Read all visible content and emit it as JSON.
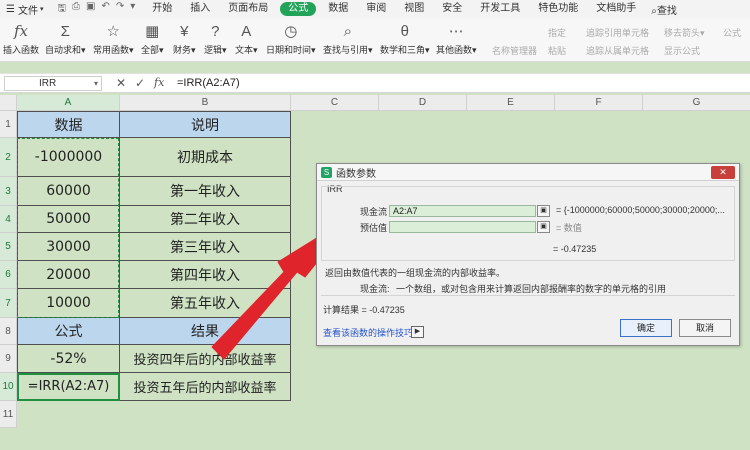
{
  "menu": {
    "file": "文件",
    "tabs": [
      "开始",
      "插入",
      "页面布局",
      "公式",
      "数据",
      "审阅",
      "视图",
      "安全",
      "开发工具",
      "特色功能",
      "文档助手"
    ],
    "active_tab": "公式",
    "search": "查找"
  },
  "ribbon": {
    "buttons": [
      {
        "label": "插入函数",
        "icon": "fx"
      },
      {
        "label": "自动求和▾",
        "icon": "Σ"
      },
      {
        "label": "常用函数▾",
        "icon": "☆"
      },
      {
        "label": "全部▾",
        "icon": "▦"
      },
      {
        "label": "财务▾",
        "icon": "¥"
      },
      {
        "label": "逻辑▾",
        "icon": "?"
      },
      {
        "label": "文本▾",
        "icon": "A"
      },
      {
        "label": "日期和时间▾",
        "icon": "◷"
      },
      {
        "label": "查找与引用▾",
        "icon": "⌕"
      },
      {
        "label": "数学和三角▾",
        "icon": "θ"
      },
      {
        "label": "其他函数▾",
        "icon": "⋯"
      }
    ],
    "right_items": [
      "名称管理器",
      "指定",
      "粘贴",
      "追踪引用单元格",
      "追踪从属单元格",
      "移去箭头▾",
      "显示公式",
      "公式"
    ]
  },
  "formula_bar": {
    "name_box": "IRR",
    "formula": "=IRR(A2:A7)",
    "cancel": "✕",
    "enter": "✓",
    "fx": "fx"
  },
  "columns": [
    "A",
    "B",
    "C",
    "D",
    "E",
    "F",
    "G"
  ],
  "rows": [
    "1",
    "2",
    "3",
    "4",
    "5",
    "6",
    "7",
    "8",
    "9",
    "10",
    "11"
  ],
  "cells": {
    "A1": "数据",
    "B1": "说明",
    "A2": "-1000000",
    "B2": "初期成本",
    "A3": "60000",
    "B3": "第一年收入",
    "A4": "50000",
    "B4": "第二年收入",
    "A5": "30000",
    "B5": "第三年收入",
    "A6": "20000",
    "B6": "第四年收入",
    "A7": "10000",
    "B7": "第五年收入",
    "A8": "公式",
    "B8": "结果",
    "A9": "-52%",
    "B9": "投资四年后的内部收益率",
    "A10": "=IRR(A2:A7)",
    "B10": "投资五年后的内部收益率"
  },
  "dialog": {
    "title": "函数参数",
    "close": "✕",
    "function_name": "IRR",
    "arg1_label": "现金流",
    "arg1_value": "A2:A7",
    "arg1_result": "= {-1000000;60000;50000;30000;20000;...",
    "arg2_label": "预估值",
    "arg2_value": "",
    "arg2_result": "= 数值",
    "overall_result": "= -0.47235",
    "description": "返回由数值代表的一组现金流的内部收益率。",
    "arg_desc_label": "现金流:",
    "arg_desc": "一个数组，或对包含用来计算返回内部报酬率的数字的单元格的引用",
    "calc_result": "计算结果 = -0.47235",
    "help_link": "查看该函数的操作技巧",
    "ok": "确定",
    "cancel": "取消"
  },
  "colors": {
    "sheet_bg": "#cfe3c4",
    "header_fill": "#bcd6ee",
    "active_tab": "#22a35a",
    "arrow": "#e0242b",
    "input_fill": "#dbefd8"
  }
}
